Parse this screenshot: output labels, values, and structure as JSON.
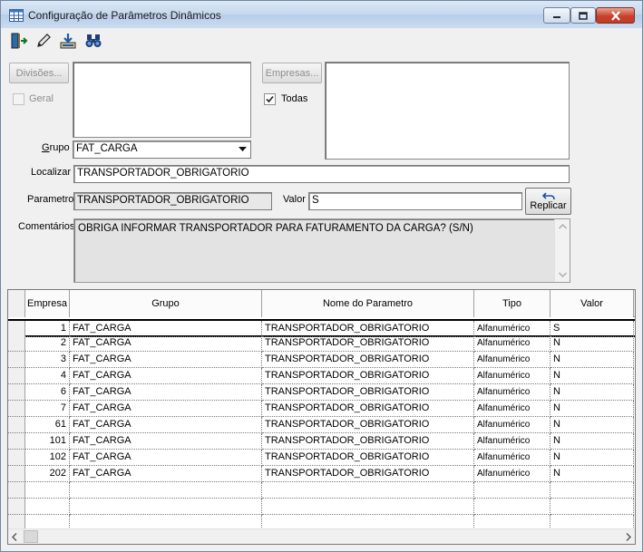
{
  "window": {
    "title": "Configuração de Parâmetros Dinâmicos"
  },
  "toolbar": {
    "icons": [
      "exit-icon",
      "pencil-icon",
      "save-icon",
      "binoculars-icon"
    ]
  },
  "divisions": {
    "button_label": "Divisões...",
    "geral_label": "Geral",
    "geral_checked": false
  },
  "companies": {
    "button_label": "Empresas...",
    "todas_label": "Todas",
    "todas_checked": true
  },
  "form": {
    "grupo_label": "Grupo",
    "grupo_value": "FAT_CARGA",
    "localizar_label": "Localizar",
    "localizar_value": "TRANSPORTADOR_OBRIGATORIO",
    "parametro_label": "Parametro",
    "parametro_value": "TRANSPORTADOR_OBRIGATORIO",
    "valor_label": "Valor",
    "valor_value": "S",
    "replicar_label": "Replicar",
    "comentarios_label": "Comentários",
    "comentarios_value": "OBRIGA INFORMAR TRANSPORTADOR PARA FATURAMENTO DA CARGA? (S/N)"
  },
  "grid": {
    "columns": [
      "Empresa",
      "Grupo",
      "Nome do Parametro",
      "Tipo",
      "Valor"
    ],
    "rows": [
      [
        "1",
        "FAT_CARGA",
        "TRANSPORTADOR_OBRIGATORIO",
        "Alfanumérico",
        "S"
      ],
      [
        "2",
        "FAT_CARGA",
        "TRANSPORTADOR_OBRIGATORIO",
        "Alfanumérico",
        "N"
      ],
      [
        "3",
        "FAT_CARGA",
        "TRANSPORTADOR_OBRIGATORIO",
        "Alfanumérico",
        "N"
      ],
      [
        "4",
        "FAT_CARGA",
        "TRANSPORTADOR_OBRIGATORIO",
        "Alfanumérico",
        "N"
      ],
      [
        "6",
        "FAT_CARGA",
        "TRANSPORTADOR_OBRIGATORIO",
        "Alfanumérico",
        "N"
      ],
      [
        "7",
        "FAT_CARGA",
        "TRANSPORTADOR_OBRIGATORIO",
        "Alfanumérico",
        "N"
      ],
      [
        "61",
        "FAT_CARGA",
        "TRANSPORTADOR_OBRIGATORIO",
        "Alfanumérico",
        "N"
      ],
      [
        "101",
        "FAT_CARGA",
        "TRANSPORTADOR_OBRIGATORIO",
        "Alfanumérico",
        "N"
      ],
      [
        "102",
        "FAT_CARGA",
        "TRANSPORTADOR_OBRIGATORIO",
        "Alfanumérico",
        "N"
      ],
      [
        "202",
        "FAT_CARGA",
        "TRANSPORTADOR_OBRIGATORIO",
        "Alfanumérico",
        "N"
      ]
    ],
    "selected_row": 0
  },
  "colors": {
    "titlebar": "#c5d8ee",
    "close_button": "#c8412c",
    "field_readonly": "#e8e8e8"
  }
}
